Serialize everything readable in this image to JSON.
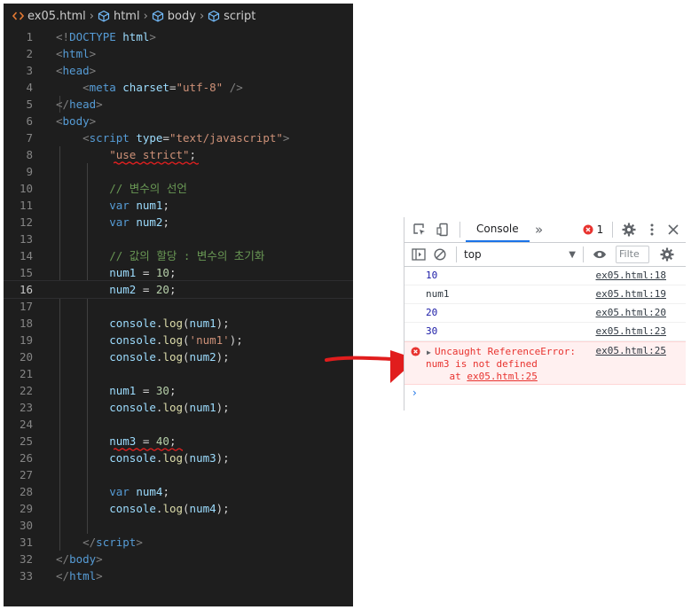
{
  "breadcrumb": {
    "file": "ex05.html",
    "items": [
      "html",
      "body",
      "script"
    ]
  },
  "editor": {
    "lines": [
      {
        "n": "1"
      },
      {
        "n": "2"
      },
      {
        "n": "3"
      },
      {
        "n": "4"
      },
      {
        "n": "5"
      },
      {
        "n": "6"
      },
      {
        "n": "7"
      },
      {
        "n": "8"
      },
      {
        "n": "9"
      },
      {
        "n": "10"
      },
      {
        "n": "11"
      },
      {
        "n": "12"
      },
      {
        "n": "13"
      },
      {
        "n": "14"
      },
      {
        "n": "15"
      },
      {
        "n": "16"
      },
      {
        "n": "17"
      },
      {
        "n": "18"
      },
      {
        "n": "19"
      },
      {
        "n": "20"
      },
      {
        "n": "21"
      },
      {
        "n": "22"
      },
      {
        "n": "23"
      },
      {
        "n": "24"
      },
      {
        "n": "25"
      },
      {
        "n": "26"
      },
      {
        "n": "27"
      },
      {
        "n": "28"
      },
      {
        "n": "29"
      },
      {
        "n": "30"
      },
      {
        "n": "31"
      },
      {
        "n": "32"
      },
      {
        "n": "33"
      }
    ],
    "current_line": "16",
    "code": [
      [
        [
          "br",
          "<!"
        ],
        [
          "tag",
          "DOCTYPE"
        ],
        [
          "txt",
          " "
        ],
        [
          "attr",
          "html"
        ],
        [
          "br",
          ">"
        ]
      ],
      [
        [
          "br",
          "<"
        ],
        [
          "tag",
          "html"
        ],
        [
          "br",
          ">"
        ]
      ],
      [
        [
          "br",
          "<"
        ],
        [
          "tag",
          "head"
        ],
        [
          "br",
          ">"
        ]
      ],
      [
        [
          "txt",
          "    "
        ],
        [
          "br",
          "<"
        ],
        [
          "tag",
          "meta"
        ],
        [
          "txt",
          " "
        ],
        [
          "attr",
          "charset"
        ],
        [
          "txt",
          "="
        ],
        [
          "str",
          "\"utf-8\""
        ],
        [
          "txt",
          " "
        ],
        [
          "br",
          "/>"
        ]
      ],
      [
        [
          "br",
          "</"
        ],
        [
          "tag",
          "head"
        ],
        [
          "br",
          ">"
        ]
      ],
      [
        [
          "br",
          "<"
        ],
        [
          "tag",
          "body"
        ],
        [
          "br",
          ">"
        ]
      ],
      [
        [
          "txt",
          "    "
        ],
        [
          "br",
          "<"
        ],
        [
          "tag",
          "script"
        ],
        [
          "txt",
          " "
        ],
        [
          "attr",
          "type"
        ],
        [
          "txt",
          "="
        ],
        [
          "str",
          "\"text/javascript\""
        ],
        [
          "br",
          ">"
        ]
      ],
      [
        [
          "txt",
          "        "
        ],
        [
          "str",
          "\"use strict\""
        ],
        [
          "txt",
          ";"
        ]
      ],
      [],
      [
        [
          "txt",
          "        "
        ],
        [
          "com",
          "// 변수의 선언"
        ]
      ],
      [
        [
          "txt",
          "        "
        ],
        [
          "kw",
          "var"
        ],
        [
          "txt",
          " "
        ],
        [
          "var",
          "num1"
        ],
        [
          "txt",
          ";"
        ]
      ],
      [
        [
          "txt",
          "        "
        ],
        [
          "kw",
          "var"
        ],
        [
          "txt",
          " "
        ],
        [
          "var",
          "num2"
        ],
        [
          "txt",
          ";"
        ]
      ],
      [],
      [
        [
          "txt",
          "        "
        ],
        [
          "com",
          "// 값의 할당 : 변수의 초기화"
        ]
      ],
      [
        [
          "txt",
          "        "
        ],
        [
          "var",
          "num1"
        ],
        [
          "txt",
          " = "
        ],
        [
          "num",
          "10"
        ],
        [
          "txt",
          ";"
        ]
      ],
      [
        [
          "txt",
          "        "
        ],
        [
          "var",
          "num2"
        ],
        [
          "txt",
          " = "
        ],
        [
          "num",
          "20"
        ],
        [
          "txt",
          ";"
        ]
      ],
      [],
      [
        [
          "txt",
          "        "
        ],
        [
          "var",
          "console"
        ],
        [
          "txt",
          "."
        ],
        [
          "fn",
          "log"
        ],
        [
          "txt",
          "("
        ],
        [
          "var",
          "num1"
        ],
        [
          "txt",
          ");"
        ]
      ],
      [
        [
          "txt",
          "        "
        ],
        [
          "var",
          "console"
        ],
        [
          "txt",
          "."
        ],
        [
          "fn",
          "log"
        ],
        [
          "txt",
          "("
        ],
        [
          "str",
          "'num1'"
        ],
        [
          "txt",
          ");"
        ]
      ],
      [
        [
          "txt",
          "        "
        ],
        [
          "var",
          "console"
        ],
        [
          "txt",
          "."
        ],
        [
          "fn",
          "log"
        ],
        [
          "txt",
          "("
        ],
        [
          "var",
          "num2"
        ],
        [
          "txt",
          ");"
        ]
      ],
      [],
      [
        [
          "txt",
          "        "
        ],
        [
          "var",
          "num1"
        ],
        [
          "txt",
          " = "
        ],
        [
          "num",
          "30"
        ],
        [
          "txt",
          ";"
        ]
      ],
      [
        [
          "txt",
          "        "
        ],
        [
          "var",
          "console"
        ],
        [
          "txt",
          "."
        ],
        [
          "fn",
          "log"
        ],
        [
          "txt",
          "("
        ],
        [
          "var",
          "num1"
        ],
        [
          "txt",
          ");"
        ]
      ],
      [],
      [
        [
          "txt",
          "        "
        ],
        [
          "var",
          "num3"
        ],
        [
          "txt",
          " = "
        ],
        [
          "num",
          "40"
        ],
        [
          "txt",
          ";"
        ]
      ],
      [
        [
          "txt",
          "        "
        ],
        [
          "var",
          "console"
        ],
        [
          "txt",
          "."
        ],
        [
          "fn",
          "log"
        ],
        [
          "txt",
          "("
        ],
        [
          "var",
          "num3"
        ],
        [
          "txt",
          ");"
        ]
      ],
      [],
      [
        [
          "txt",
          "        "
        ],
        [
          "kw",
          "var"
        ],
        [
          "txt",
          " "
        ],
        [
          "var",
          "num4"
        ],
        [
          "txt",
          ";"
        ]
      ],
      [
        [
          "txt",
          "        "
        ],
        [
          "var",
          "console"
        ],
        [
          "txt",
          "."
        ],
        [
          "fn",
          "log"
        ],
        [
          "txt",
          "("
        ],
        [
          "var",
          "num4"
        ],
        [
          "txt",
          ");"
        ]
      ],
      [],
      [
        [
          "txt",
          "    "
        ],
        [
          "br",
          "</"
        ],
        [
          "tag",
          "script"
        ],
        [
          "br",
          ">"
        ]
      ],
      [
        [
          "br",
          "</"
        ],
        [
          "tag",
          "body"
        ],
        [
          "br",
          ">"
        ]
      ],
      [
        [
          "br",
          "</"
        ],
        [
          "tag",
          "html"
        ],
        [
          "br",
          ">"
        ]
      ]
    ]
  },
  "devtools": {
    "tab_console": "Console",
    "more_tabs": "»",
    "error_count": "1",
    "context": "top",
    "filter_placeholder": "Filte",
    "messages": [
      {
        "value": "10",
        "source": "ex05.html:18",
        "kind": "number"
      },
      {
        "value": "num1",
        "source": "ex05.html:19",
        "kind": "string"
      },
      {
        "value": "20",
        "source": "ex05.html:20",
        "kind": "number"
      },
      {
        "value": "30",
        "source": "ex05.html:23",
        "kind": "number"
      }
    ],
    "error": {
      "line1": "Uncaught ReferenceError:",
      "line2": "num3 is not defined",
      "line3_prefix": "    at ",
      "line3_link": "ex05.html:25",
      "source": "ex05.html:25"
    },
    "prompt": "›"
  },
  "colors": {
    "editor_bg": "#1e1e1e",
    "error_red": "#e8332f",
    "squiggle_red": "#e02020",
    "number_blue": "#1a1aa6"
  }
}
